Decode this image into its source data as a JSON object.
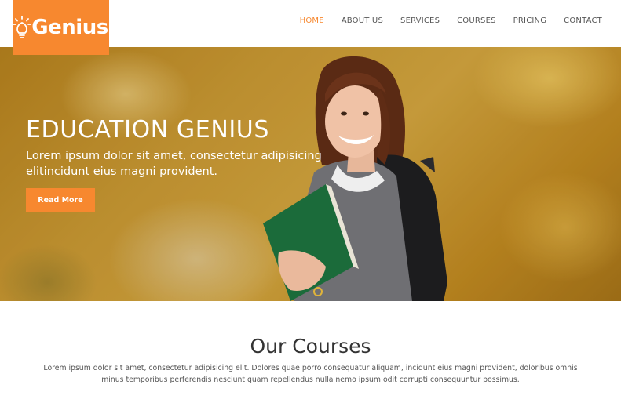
{
  "brand": {
    "name": "Genius",
    "color": "#f7882f"
  },
  "nav": {
    "items": [
      {
        "label": "HOME",
        "active": true
      },
      {
        "label": "ABOUT US",
        "active": false
      },
      {
        "label": "SERVICES",
        "active": false
      },
      {
        "label": "COURSES",
        "active": false
      },
      {
        "label": "PRICING",
        "active": false
      },
      {
        "label": "CONTACT",
        "active": false
      }
    ]
  },
  "hero": {
    "title": "EDUCATION GENIUS",
    "subtitle": "Lorem ipsum dolor sit amet, consectetur adipisicing elitincidunt eius magni provident.",
    "button_label": "Read More"
  },
  "courses": {
    "title": "Our Courses",
    "description": "Lorem ipsum dolor sit amet, consectetur adipisicing elit. Dolores quae porro consequatur aliquam, incidunt eius magni provident, doloribus omnis minus temporibus perferendis nesciunt quam repellendus nulla nemo ipsum odit corrupti consequuntur possimus."
  }
}
